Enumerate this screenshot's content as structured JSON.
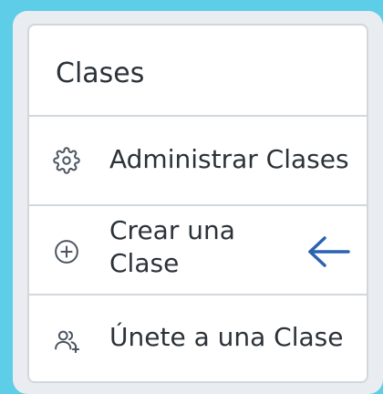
{
  "menu": {
    "title": "Clases",
    "items": [
      {
        "label": "Administrar Clases",
        "icon": "gear-icon"
      },
      {
        "label": "Crear una Clase",
        "icon": "plus-circle-icon"
      },
      {
        "label": "Únete a una Clase",
        "icon": "users-add-icon"
      }
    ]
  },
  "indicator": {
    "icon": "arrow-left-icon",
    "color": "#2a64b0"
  },
  "colors": {
    "background": "#5ecde8",
    "panel": "#e9edf1",
    "card": "#ffffff",
    "divider": "#d2d7dc",
    "text": "#2b3238"
  }
}
